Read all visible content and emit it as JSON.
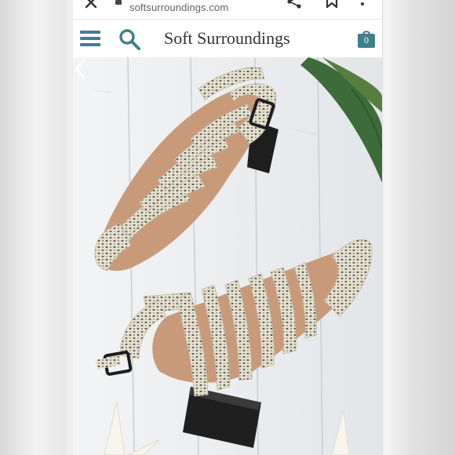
{
  "browser": {
    "url": "softsurroundings.com",
    "icons": [
      "close-icon",
      "lock-icon",
      "share-icon",
      "bookmark-icon",
      "more-vertical-icon"
    ]
  },
  "header": {
    "brand": "Soft Surroundings",
    "cart_count": "0",
    "icons": [
      "menu-icon",
      "search-icon",
      "cart-icon"
    ]
  },
  "colors": {
    "accent": "#3f7f8c",
    "text": "#333333"
  },
  "hero": {
    "icons": [
      "chevron-left-icon"
    ]
  }
}
